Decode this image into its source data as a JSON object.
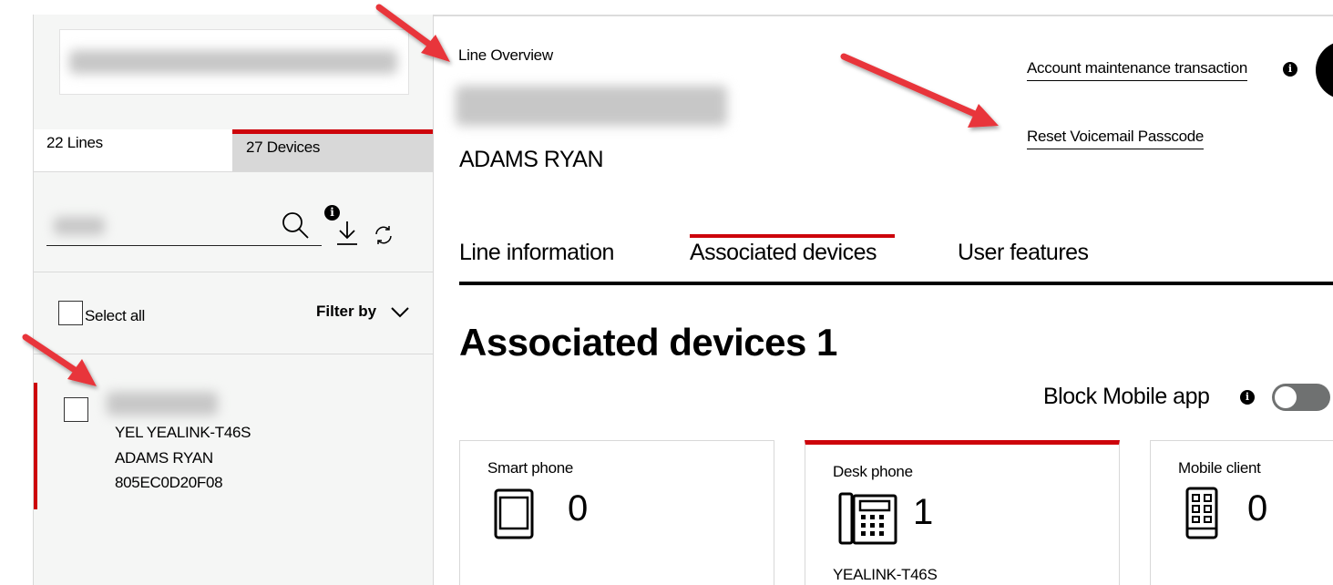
{
  "sidebar": {
    "tabs": [
      {
        "label": "22 Lines"
      },
      {
        "label": "27 Devices"
      }
    ],
    "select_all_label": "Select all",
    "filter_label": "Filter by",
    "device": {
      "model": "YEL YEALINK-T46S",
      "user": "ADAMS RYAN",
      "mac": "805EC0D20F08"
    }
  },
  "header": {
    "title": "Line Overview",
    "user_name": "ADAMS RYAN",
    "links": {
      "account_maintenance": "Account maintenance transaction",
      "reset_voicemail": "Reset Voicemail Passcode"
    }
  },
  "tabs": [
    {
      "label": "Line information"
    },
    {
      "label": "Associated devices"
    },
    {
      "label": "User features"
    }
  ],
  "section": {
    "title": "Associated devices 1",
    "block_mobile_label": "Block Mobile app",
    "block_mobile_enabled": false
  },
  "cards": [
    {
      "label": "Smart phone",
      "count": "0",
      "icon": "smartphone-icon"
    },
    {
      "label": "Desk phone",
      "count": "1",
      "icon": "desk-phone-icon",
      "model": "YEALINK-T46S"
    },
    {
      "label": "Mobile client",
      "count": "0",
      "icon": "mobile-client-icon"
    }
  ],
  "colors": {
    "accent": "#cd040b",
    "sidebar_bg": "#f5f6f5",
    "annotation_arrow": "#e8343a"
  }
}
